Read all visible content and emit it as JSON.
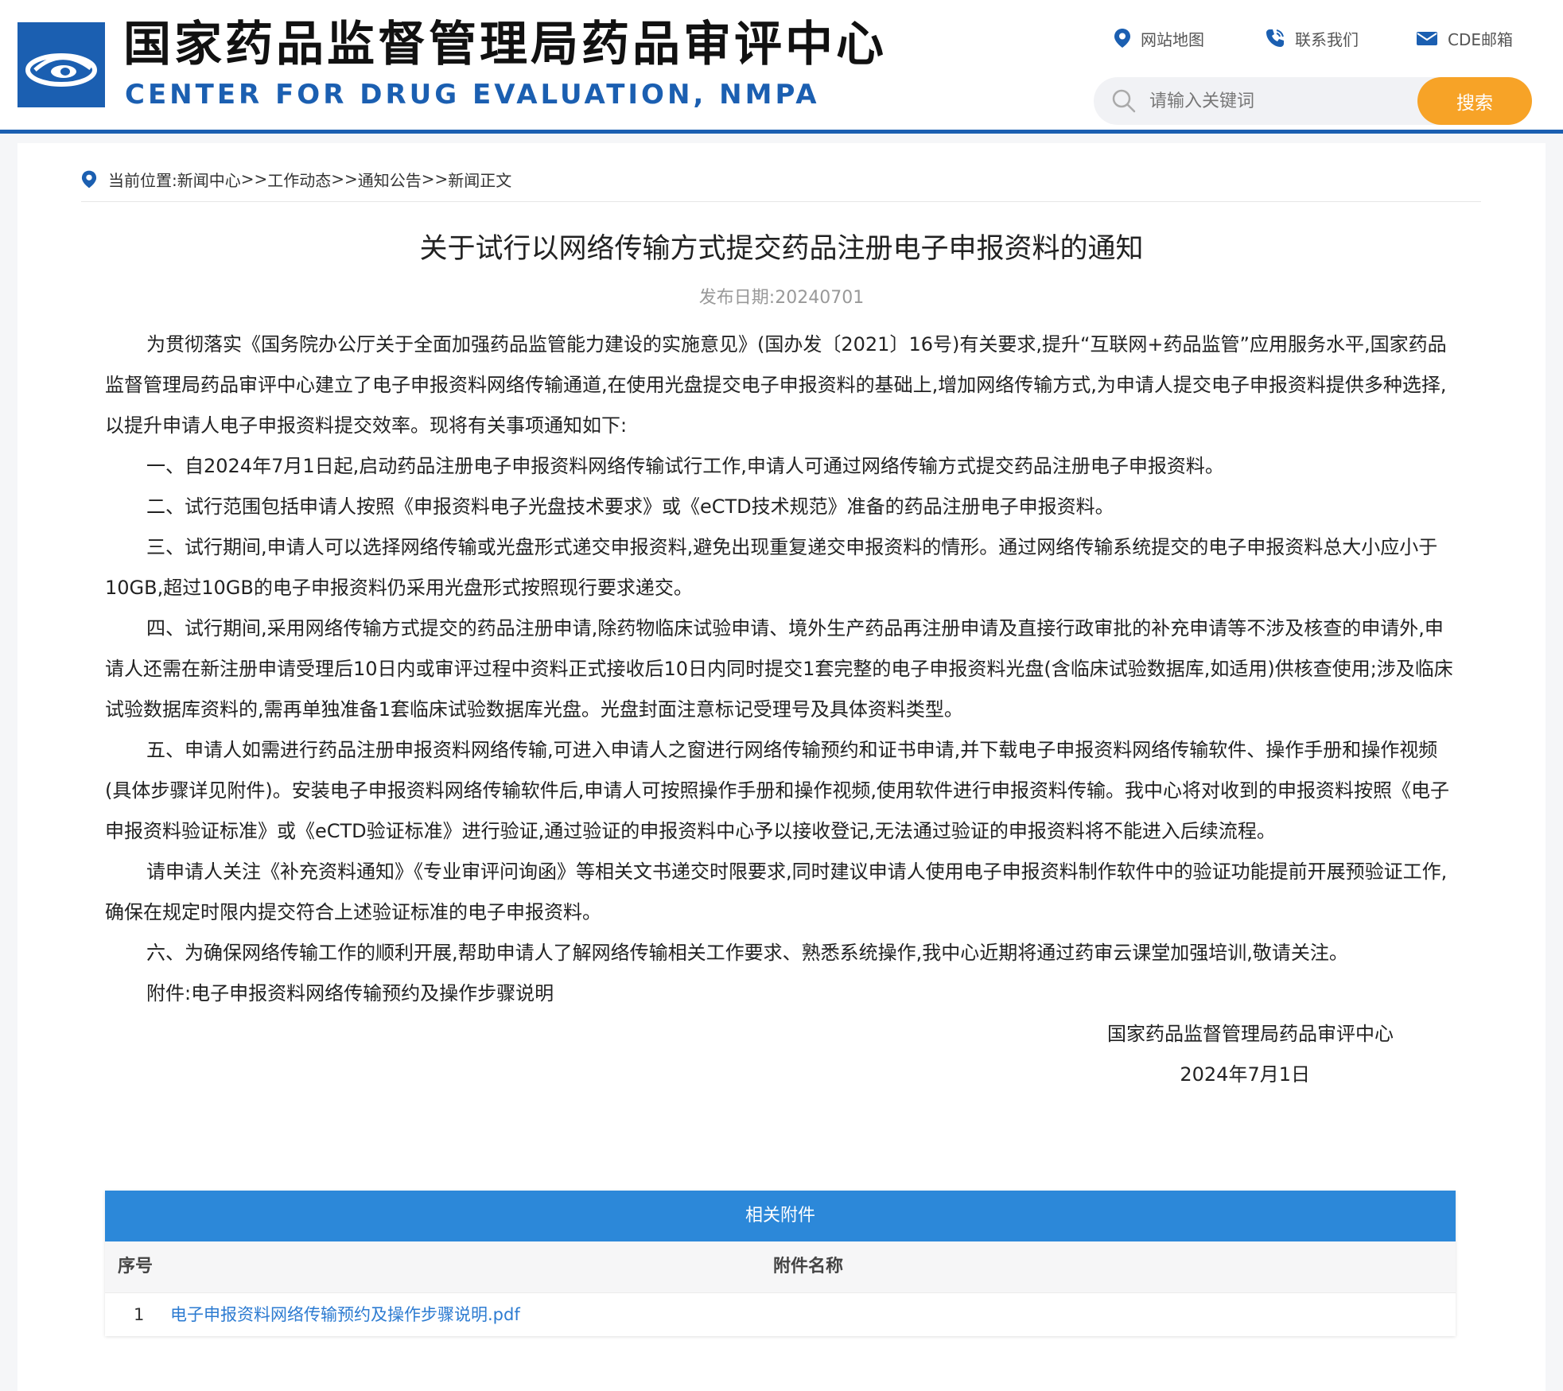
{
  "header": {
    "title_cn": "国家药品监督管理局药品审评中心",
    "title_en": "CENTER FOR DRUG EVALUATION, NMPA",
    "links": [
      {
        "label": "网站地图",
        "icon": "map-pin-icon"
      },
      {
        "label": "联系我们",
        "icon": "phone-icon"
      },
      {
        "label": "CDE邮箱",
        "icon": "mail-icon"
      }
    ],
    "search": {
      "placeholder": "请输入关键词",
      "button": "搜索"
    },
    "colors": {
      "brand": "#1b5fb1",
      "search_button": "#f7a327"
    }
  },
  "breadcrumb": {
    "prefix": "当前位置:",
    "items": [
      "新闻中心",
      "工作动态",
      "通知公告",
      "新闻正文"
    ],
    "separator": ">>"
  },
  "article": {
    "title": "关于试行以网络传输方式提交药品注册电子申报资料的通知",
    "date_label": "发布日期:",
    "date_value": "20240701",
    "paragraphs": [
      "为贯彻落实《国务院办公厅关于全面加强药品监管能力建设的实施意见》(国办发〔2021〕16号)有关要求,提升“互联网+药品监管”应用服务水平,国家药品监督管理局药品审评中心建立了电子申报资料网络传输通道,在使用光盘提交电子申报资料的基础上,增加网络传输方式,为申请人提交电子申报资料提供多种选择,以提升申请人电子申报资料提交效率。现将有关事项通知如下:",
      "一、自2024年7月1日起,启动药品注册电子申报资料网络传输试行工作,申请人可通过网络传输方式提交药品注册电子申报资料。",
      "二、试行范围包括申请人按照《申报资料电子光盘技术要求》或《eCTD技术规范》准备的药品注册电子申报资料。",
      "三、试行期间,申请人可以选择网络传输或光盘形式递交申报资料,避免出现重复递交申报资料的情形。通过网络传输系统提交的电子申报资料总大小应小于10GB,超过10GB的电子申报资料仍采用光盘形式按照现行要求递交。",
      "四、试行期间,采用网络传输方式提交的药品注册申请,除药物临床试验申请、境外生产药品再注册申请及直接行政审批的补充申请等不涉及核查的申请外,申请人还需在新注册申请受理后10日内或审评过程中资料正式接收后10日内同时提交1套完整的电子申报资料光盘(含临床试验数据库,如适用)供核查使用;涉及临床试验数据库资料的,需再单独准备1套临床试验数据库光盘。光盘封面注意标记受理号及具体资料类型。",
      "五、申请人如需进行药品注册申报资料网络传输,可进入申请人之窗进行网络传输预约和证书申请,并下载电子申报资料网络传输软件、操作手册和操作视频(具体步骤详见附件)。安装电子申报资料网络传输软件后,申请人可按照操作手册和操作视频,使用软件进行申报资料传输。我中心将对收到的申报资料按照《电子申报资料验证标准》或《eCTD验证标准》进行验证,通过验证的申报资料中心予以接收登记,无法通过验证的申报资料将不能进入后续流程。",
      "请申请人关注《补充资料通知》《专业审评问询函》等相关文书递交时限要求,同时建议申请人使用电子申报资料制作软件中的验证功能提前开展预验证工作,确保在规定时限内提交符合上述验证标准的电子申报资料。",
      "六、为确保网络传输工作的顺利开展,帮助申请人了解网络传输相关工作要求、熟悉系统操作,我中心近期将通过药审云课堂加强培训,敬请关注。",
      "附件:电子申报资料网络传输预约及操作步骤说明"
    ],
    "signature": "国家药品监督管理局药品审评中心",
    "sign_date": "2024年7月1日"
  },
  "attachments": {
    "title": "相关附件",
    "columns": [
      "序号",
      "附件名称"
    ],
    "rows": [
      {
        "no": "1",
        "name": "电子申报资料网络传输预约及操作步骤说明.pdf"
      }
    ]
  }
}
